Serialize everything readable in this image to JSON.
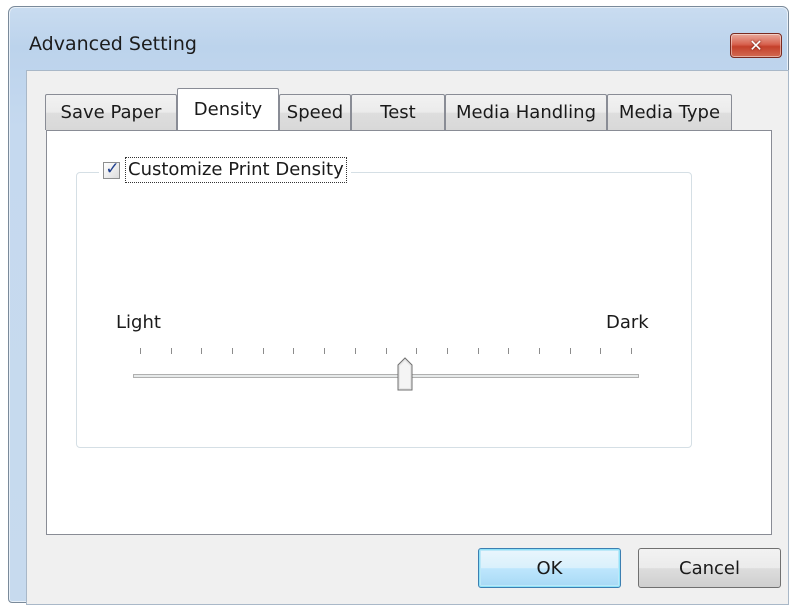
{
  "window": {
    "title": "Advanced Setting",
    "close_symbol": "✕"
  },
  "tabs": [
    {
      "label": "Save Paper",
      "active": false
    },
    {
      "label": "Density",
      "active": true
    },
    {
      "label": "Speed",
      "active": false
    },
    {
      "label": "Test",
      "active": false
    },
    {
      "label": "Media Handling",
      "active": false
    },
    {
      "label": "Media Type",
      "active": false
    }
  ],
  "density": {
    "checkbox_label": "Customize Print Density",
    "checkbox_checked": true,
    "check_glyph": "✓",
    "slider_min_label": "Light",
    "slider_max_label": "Dark",
    "slider_value_fraction": 0.54,
    "tick_count": 17
  },
  "buttons": {
    "ok_label": "OK",
    "cancel_label": "Cancel"
  },
  "colors": {
    "title_bar": "#bcd3ec",
    "close_button": "#c4402b",
    "default_button_border": "#3c7fb1"
  }
}
